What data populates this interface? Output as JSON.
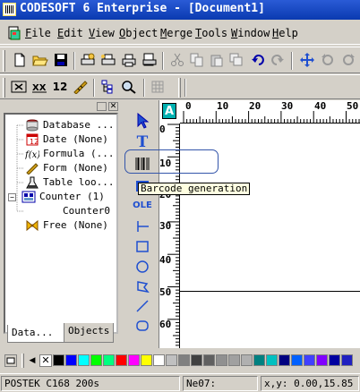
{
  "window": {
    "title": "CODESOFT 6 Enterprise - [Document1]"
  },
  "menu": [
    {
      "label": "File",
      "key": "F",
      "rest": "ile"
    },
    {
      "label": "Edit",
      "key": "E",
      "rest": "dit"
    },
    {
      "label": "View",
      "key": "V",
      "rest": "iew"
    },
    {
      "label": "Object",
      "key": "O",
      "rest": "bject"
    },
    {
      "label": "Merge",
      "key": "M",
      "rest": "erge"
    },
    {
      "label": "Tools",
      "key": "T",
      "rest": "ools"
    },
    {
      "label": "Window",
      "key": "W",
      "rest": "indow"
    },
    {
      "label": "Help",
      "key": "H",
      "rest": "elp"
    }
  ],
  "toolbar2": {
    "num_label": "12"
  },
  "panel": {
    "items": [
      {
        "label": "Database ...",
        "icon": "database-icon"
      },
      {
        "label": "Date (None)",
        "icon": "calendar-icon"
      },
      {
        "label": "Formula (...",
        "icon": "formula-icon"
      },
      {
        "label": "Form (None)",
        "icon": "form-icon"
      },
      {
        "label": "Table loo...",
        "icon": "table-lookup-icon"
      },
      {
        "label": "Counter (1)",
        "icon": "counter-icon",
        "expander": "−"
      },
      {
        "label": "Counter0",
        "icon": ""
      },
      {
        "label": "Free (None)",
        "icon": "free-icon"
      }
    ],
    "tabs": [
      {
        "label": "Data..."
      },
      {
        "label": "Objects"
      }
    ]
  },
  "tools": {
    "text_tool_label": "T",
    "ole_label": "OLE"
  },
  "ruler": {
    "top": [
      "0",
      "10",
      "20",
      "30",
      "40",
      "50"
    ],
    "left": [
      "0",
      "10",
      "20",
      "30",
      "40",
      "50",
      "60"
    ],
    "corner_label": "A"
  },
  "tooltip": {
    "text": "Barcode generation"
  },
  "status": {
    "printer": "POSTEK C168 200s",
    "field2": "Ne07:",
    "coords": "x,y: 0.00,15.85"
  },
  "palette": [
    "#000000",
    "#0000ff",
    "#00ffff",
    "#00ff00",
    "#00ff80",
    "#ff0000",
    "#ff00ff",
    "#ffff00",
    "#ffffff",
    "#c0c0c0",
    "#808080",
    "#404040",
    "#606060",
    "#909090",
    "#a0a0a0",
    "#b0b0b0",
    "#008080",
    "#00c0c0",
    "#000080",
    "#0060ff",
    "#4040ff",
    "#8000ff",
    "#0000a0",
    "#2020c0"
  ]
}
